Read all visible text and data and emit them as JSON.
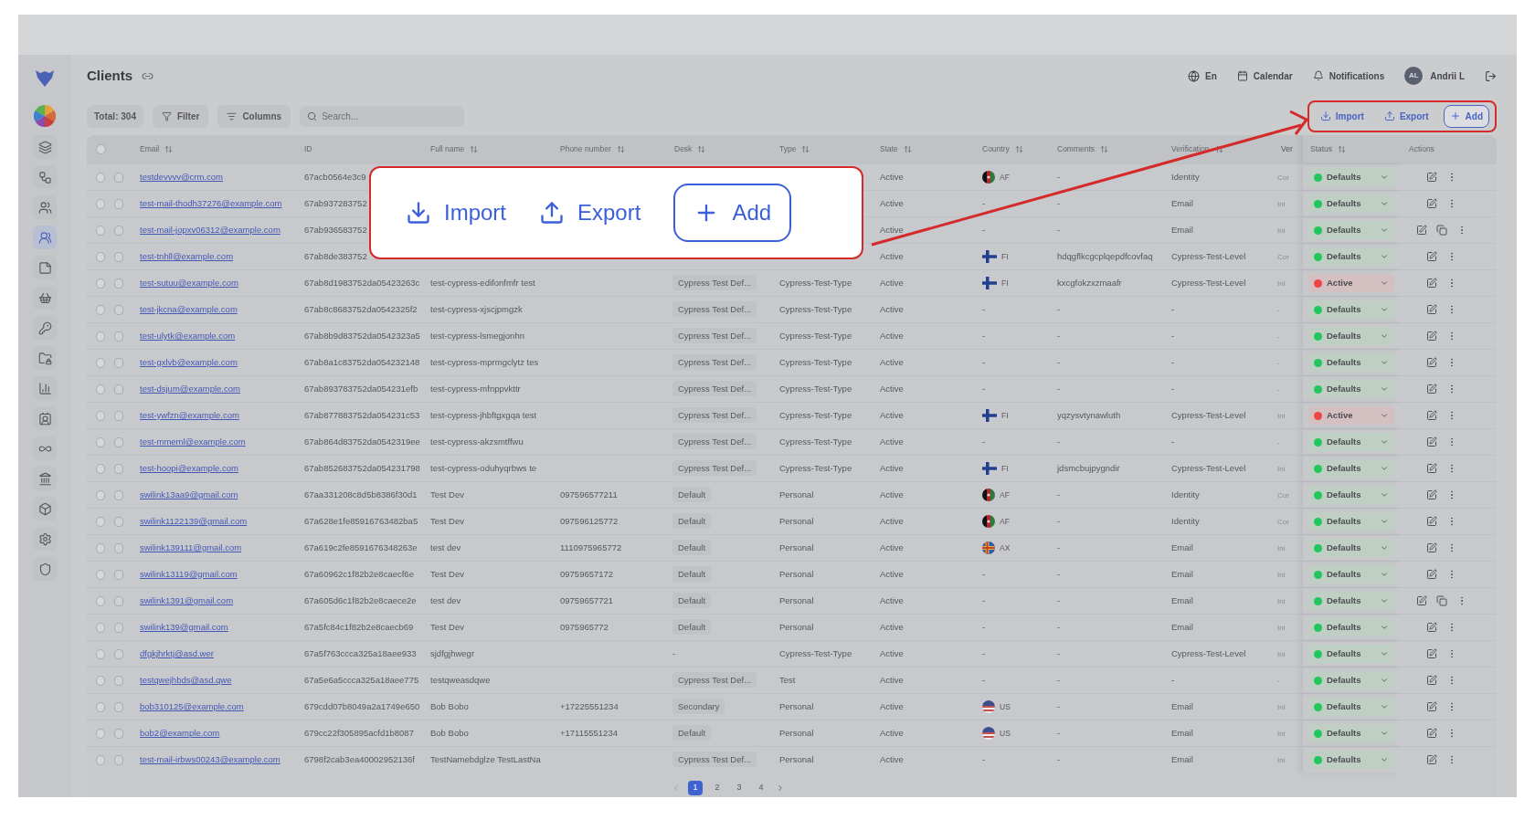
{
  "sidebar": {
    "items": [
      {
        "selected": false
      },
      {
        "selected": false
      },
      {
        "selected": false
      },
      {
        "selected": true
      },
      {
        "selected": false
      },
      {
        "selected": false
      },
      {
        "selected": false
      },
      {
        "selected": false
      },
      {
        "selected": false
      },
      {
        "selected": false
      },
      {
        "selected": false
      },
      {
        "selected": false
      },
      {
        "selected": false
      },
      {
        "selected": false
      },
      {
        "selected": false
      }
    ]
  },
  "header": {
    "title": "Clients",
    "language": "En",
    "calendar": "Calendar",
    "notifications": "Notifications",
    "avatar": "AL",
    "user": "Andrii L"
  },
  "toolbar": {
    "total": "Total: 304",
    "filter": "Filter",
    "columns": "Columns",
    "search_placeholder": "Search...",
    "actions": [
      "Import",
      "Export",
      "Add"
    ]
  },
  "callout": {
    "actions": [
      "Import",
      "Export",
      "Add"
    ]
  },
  "table": {
    "columns": [
      {
        "label": "Email",
        "sortable": true
      },
      {
        "label": "ID",
        "sortable": false
      },
      {
        "label": "Full name",
        "sortable": true
      },
      {
        "label": "Phone number",
        "sortable": true
      },
      {
        "label": "Desk",
        "sortable": true
      },
      {
        "label": "Type",
        "sortable": true
      },
      {
        "label": "State",
        "sortable": true
      },
      {
        "label": "Country",
        "sortable": true
      },
      {
        "label": "Comments",
        "sortable": true
      },
      {
        "label": "Verification",
        "sortable": true
      },
      {
        "label": "Ver"
      },
      {
        "label": "Status",
        "sortable": true
      },
      {
        "label": "Actions",
        "sortable": false
      }
    ],
    "select_all": {
      "checked": false
    },
    "rows": [
      {
        "checked": false,
        "selected": false,
        "email": "testdevvvv@crm.com",
        "id": "67acb0564e3c9",
        "state": "Active",
        "country": {
          "kind": "af",
          "code": "AF"
        },
        "comments": "-",
        "verification": "Identity",
        "ver": "Cor",
        "status": {
          "label": "Defaults",
          "color": "#22c55e"
        },
        "extra_action": false
      },
      {
        "checked": false,
        "selected": false,
        "email": "test-mail-thodh37276@example.com",
        "id": "67ab937283752",
        "state": "Active",
        "country": {
          "kind": "none",
          "text": "-"
        },
        "comments": "-",
        "verification": "Email",
        "ver": "Ini",
        "status": {
          "label": "Defaults",
          "color": "#22c55e"
        },
        "extra_action": false
      },
      {
        "checked": false,
        "selected": false,
        "email": "test-mail-jopxv06312@example.com",
        "id": "67ab936583752",
        "state": "Active",
        "country": {
          "kind": "none",
          "text": "-"
        },
        "comments": "-",
        "verification": "Email",
        "ver": "Ini",
        "status": {
          "label": "Defaults",
          "color": "#22c55e"
        },
        "extra_action": true
      },
      {
        "checked": false,
        "selected": false,
        "email": "test-tnhll@example.com",
        "id": "67ab8de383752",
        "state": "Active",
        "country": {
          "kind": "fi",
          "code": "FI"
        },
        "comments": "hdqgflkcgcplqepdfcovfaq",
        "verification": "Cypress-Test-Level",
        "ver": "Cor",
        "status": {
          "label": "Defaults",
          "color": "#22c55e"
        },
        "extra_action": false
      },
      {
        "checked": false,
        "selected": false,
        "email": "test-sutuu@example.com",
        "id": "67ab8d1983752da05423263c",
        "full_name": "test-cypress-edifonfmfr test",
        "desk": {
          "kind": "chip",
          "text": "Cypress Test Def..."
        },
        "type": "Cypress-Test-Type",
        "state": "Active",
        "country": {
          "kind": "fi",
          "code": "FI"
        },
        "comments": "kxcgfokzxzmaafr",
        "verification": "Cypress-Test-Level",
        "ver": "Ini",
        "status": {
          "label": "Active",
          "color": "#ef4444"
        },
        "extra_action": false
      },
      {
        "checked": false,
        "selected": false,
        "email": "test-jkcna@example.com",
        "id": "67ab8c8683752da0542325f2",
        "full_name": "test-cypress-xjscjpmgzk",
        "desk": {
          "kind": "chip",
          "text": "Cypress Test Def..."
        },
        "type": "Cypress-Test-Type",
        "state": "Active",
        "country": {
          "kind": "none",
          "text": "-"
        },
        "comments": "-",
        "verification": "-",
        "ver": "-",
        "status": {
          "label": "Defaults",
          "color": "#22c55e"
        },
        "extra_action": false
      },
      {
        "checked": false,
        "selected": false,
        "email": "test-ulytk@example.com",
        "id": "67ab8b9d83752da0542323a5",
        "full_name": "test-cypress-lsmegjonhn",
        "desk": {
          "kind": "chip",
          "text": "Cypress Test Def..."
        },
        "type": "Cypress-Test-Type",
        "state": "Active",
        "country": {
          "kind": "none",
          "text": "-"
        },
        "comments": "-",
        "verification": "-",
        "ver": "-",
        "status": {
          "label": "Defaults",
          "color": "#22c55e"
        },
        "extra_action": false
      },
      {
        "checked": false,
        "selected": false,
        "email": "test-gxlvb@example.com",
        "id": "67ab8a1c83752da054232148",
        "full_name": "test-cypress-mprmgclytz tes",
        "desk": {
          "kind": "chip",
          "text": "Cypress Test Def..."
        },
        "type": "Cypress-Test-Type",
        "state": "Active",
        "country": {
          "kind": "none",
          "text": "-"
        },
        "comments": "-",
        "verification": "-",
        "ver": "-",
        "status": {
          "label": "Defaults",
          "color": "#22c55e"
        },
        "extra_action": false
      },
      {
        "checked": false,
        "selected": false,
        "email": "test-dsjum@example.com",
        "id": "67ab893783752da054231efb",
        "full_name": "test-cypress-mfnppvkttr",
        "desk": {
          "kind": "chip",
          "text": "Cypress Test Def..."
        },
        "type": "Cypress-Test-Type",
        "state": "Active",
        "country": {
          "kind": "none",
          "text": "-"
        },
        "comments": "-",
        "verification": "-",
        "ver": "-",
        "status": {
          "label": "Defaults",
          "color": "#22c55e"
        },
        "extra_action": false
      },
      {
        "checked": false,
        "selected": false,
        "email": "test-ywfzn@example.com",
        "id": "67ab877883752da054231c53",
        "full_name": "test-cypress-jhbftgxgqa test",
        "desk": {
          "kind": "chip",
          "text": "Cypress Test Def..."
        },
        "type": "Cypress-Test-Type",
        "state": "Active",
        "country": {
          "kind": "fi",
          "code": "FI"
        },
        "comments": "yqzysvtynawluth",
        "verification": "Cypress-Test-Level",
        "ver": "Ini",
        "status": {
          "label": "Active",
          "color": "#ef4444"
        },
        "extra_action": false
      },
      {
        "checked": false,
        "selected": false,
        "email": "test-mmeml@example.com",
        "id": "67ab864d83752da0542319ee",
        "full_name": "test-cypress-akzsmtffwu",
        "desk": {
          "kind": "chip",
          "text": "Cypress Test Def..."
        },
        "type": "Cypress-Test-Type",
        "state": "Active",
        "country": {
          "kind": "none",
          "text": "-"
        },
        "comments": "-",
        "verification": "-",
        "ver": "-",
        "status": {
          "label": "Defaults",
          "color": "#22c55e"
        },
        "extra_action": false
      },
      {
        "checked": false,
        "selected": false,
        "email": "test-hoopi@example.com",
        "id": "67ab852683752da054231798",
        "full_name": "test-cypress-oduhyqrbws te",
        "desk": {
          "kind": "chip",
          "text": "Cypress Test Def..."
        },
        "type": "Cypress-Test-Type",
        "state": "Active",
        "country": {
          "kind": "fi",
          "code": "FI"
        },
        "comments": "jdsmcbujpygndir",
        "verification": "Cypress-Test-Level",
        "ver": "Ini",
        "status": {
          "label": "Defaults",
          "color": "#22c55e"
        },
        "extra_action": false
      },
      {
        "checked": false,
        "selected": false,
        "email": "swilink13aa9@gmail.com",
        "id": "67aa331208c8d5b8386f30d1",
        "full_name": "Test Dev",
        "phone": "097596577211",
        "desk": {
          "kind": "chip",
          "text": "Default"
        },
        "type": "Personal",
        "state": "Active",
        "country": {
          "kind": "af",
          "code": "AF"
        },
        "comments": "-",
        "verification": "Identity",
        "ver": "Cor",
        "status": {
          "label": "Defaults",
          "color": "#22c55e"
        },
        "extra_action": false
      },
      {
        "checked": false,
        "selected": false,
        "email": "swilink1122139@gmail.com",
        "id": "67a628e1fe85916763482ba5",
        "full_name": "Test Dev",
        "phone": "097596125772",
        "desk": {
          "kind": "chip",
          "text": "Default"
        },
        "type": "Personal",
        "state": "Active",
        "country": {
          "kind": "af",
          "code": "AF"
        },
        "comments": "-",
        "verification": "Identity",
        "ver": "Cor",
        "status": {
          "label": "Defaults",
          "color": "#22c55e"
        },
        "extra_action": false
      },
      {
        "checked": false,
        "selected": false,
        "email": "swilink139111@gmail.com",
        "id": "67a619c2fe8591676348263e",
        "full_name": "test dev",
        "phone": "1110975965772",
        "desk": {
          "kind": "chip",
          "text": "Default"
        },
        "type": "Personal",
        "state": "Active",
        "country": {
          "kind": "ax",
          "code": "AX"
        },
        "comments": "-",
        "verification": "Email",
        "ver": "Ini",
        "status": {
          "label": "Defaults",
          "color": "#22c55e"
        },
        "extra_action": false
      },
      {
        "checked": false,
        "selected": false,
        "email": "swilink13119@gmail.com",
        "id": "67a60962c1f82b2e8caecf6e",
        "full_name": "Test Dev",
        "phone": "09759657172",
        "desk": {
          "kind": "chip",
          "text": "Default"
        },
        "type": "Personal",
        "state": "Active",
        "country": {
          "kind": "none",
          "text": "-"
        },
        "comments": "-",
        "verification": "Email",
        "ver": "Ini",
        "status": {
          "label": "Defaults",
          "color": "#22c55e"
        },
        "extra_action": false
      },
      {
        "checked": false,
        "selected": false,
        "email": "swilink1391@gmail.com",
        "id": "67a605d6c1f82b2e8caece2e",
        "full_name": "test dev",
        "phone": "09759657721",
        "desk": {
          "kind": "chip",
          "text": "Default"
        },
        "type": "Personal",
        "state": "Active",
        "country": {
          "kind": "none",
          "text": "-"
        },
        "comments": "-",
        "verification": "Email",
        "ver": "Ini",
        "status": {
          "label": "Defaults",
          "color": "#22c55e"
        },
        "extra_action": true
      },
      {
        "checked": false,
        "selected": false,
        "email": "swilink139@gmail.com",
        "id": "67a5fc84c1f82b2e8caecb69",
        "full_name": "Test Dev",
        "phone": "0975965772",
        "desk": {
          "kind": "chip",
          "text": "Default"
        },
        "type": "Personal",
        "state": "Active",
        "country": {
          "kind": "none",
          "text": "-"
        },
        "comments": "-",
        "verification": "Email",
        "ver": "Ini",
        "status": {
          "label": "Defaults",
          "color": "#22c55e"
        },
        "extra_action": false
      },
      {
        "checked": false,
        "selected": false,
        "email": "dfgkjhrktj@asd.wer",
        "id": "67a5f763ccca325a18aee933",
        "full_name": "sjdfgjhwegr",
        "desk": {
          "kind": "plain",
          "text": "-"
        },
        "type": "Cypress-Test-Type",
        "state": "Active",
        "country": {
          "kind": "none",
          "text": "-"
        },
        "comments": "-",
        "verification": "Cypress-Test-Level",
        "ver": "Ini",
        "status": {
          "label": "Defaults",
          "color": "#22c55e"
        },
        "extra_action": false
      },
      {
        "checked": false,
        "selected": false,
        "email": "testqwejhbds@asd.qwe",
        "id": "67a5e6a5ccca325a18aee775",
        "full_name": "testqweasdqwe",
        "desk": {
          "kind": "chip",
          "text": "Cypress Test Def..."
        },
        "type": "Test",
        "state": "Active",
        "country": {
          "kind": "none",
          "text": "-"
        },
        "comments": "-",
        "verification": "-",
        "ver": "-",
        "status": {
          "label": "Defaults",
          "color": "#22c55e"
        },
        "extra_action": false
      },
      {
        "checked": false,
        "selected": false,
        "email": "bob310125@example.com",
        "id": "679cdd07b8049a2a1749e650",
        "full_name": "Bob Bobo",
        "phone": "+17225551234",
        "desk": {
          "kind": "chip",
          "text": "Secondary"
        },
        "type": "Personal",
        "state": "Active",
        "country": {
          "kind": "us",
          "code": "US"
        },
        "comments": "-",
        "verification": "Email",
        "ver": "Ini",
        "status": {
          "label": "Defaults",
          "color": "#22c55e"
        },
        "extra_action": false
      },
      {
        "checked": false,
        "selected": false,
        "email": "bob2@example.com",
        "id": "679cc22f305895acfd1b8087",
        "full_name": "Bob Bobo",
        "phone": "+17115551234",
        "desk": {
          "kind": "chip",
          "text": "Default"
        },
        "type": "Personal",
        "state": "Active",
        "country": {
          "kind": "us",
          "code": "US"
        },
        "comments": "-",
        "verification": "Email",
        "ver": "Ini",
        "status": {
          "label": "Defaults",
          "color": "#22c55e"
        },
        "extra_action": false
      },
      {
        "checked": false,
        "selected": false,
        "email": "test-mail-irbws00243@example.com",
        "id": "6798f2cab3ea40002952136f",
        "full_name": "TestNamebdglze TestLastNa",
        "desk": {
          "kind": "chip",
          "text": "Cypress Test Def..."
        },
        "type": "Personal",
        "state": "Active",
        "country": {
          "kind": "none",
          "text": "-"
        },
        "comments": "-",
        "verification": "Email",
        "ver": "Ini",
        "status": {
          "label": "Defaults",
          "color": "#22c55e"
        },
        "extra_action": false
      }
    ]
  },
  "pagination": {
    "pages": [
      {
        "label": "1",
        "selected": true
      },
      {
        "label": "2",
        "selected": false
      },
      {
        "label": "3",
        "selected": false
      },
      {
        "label": "4",
        "selected": false
      }
    ]
  }
}
